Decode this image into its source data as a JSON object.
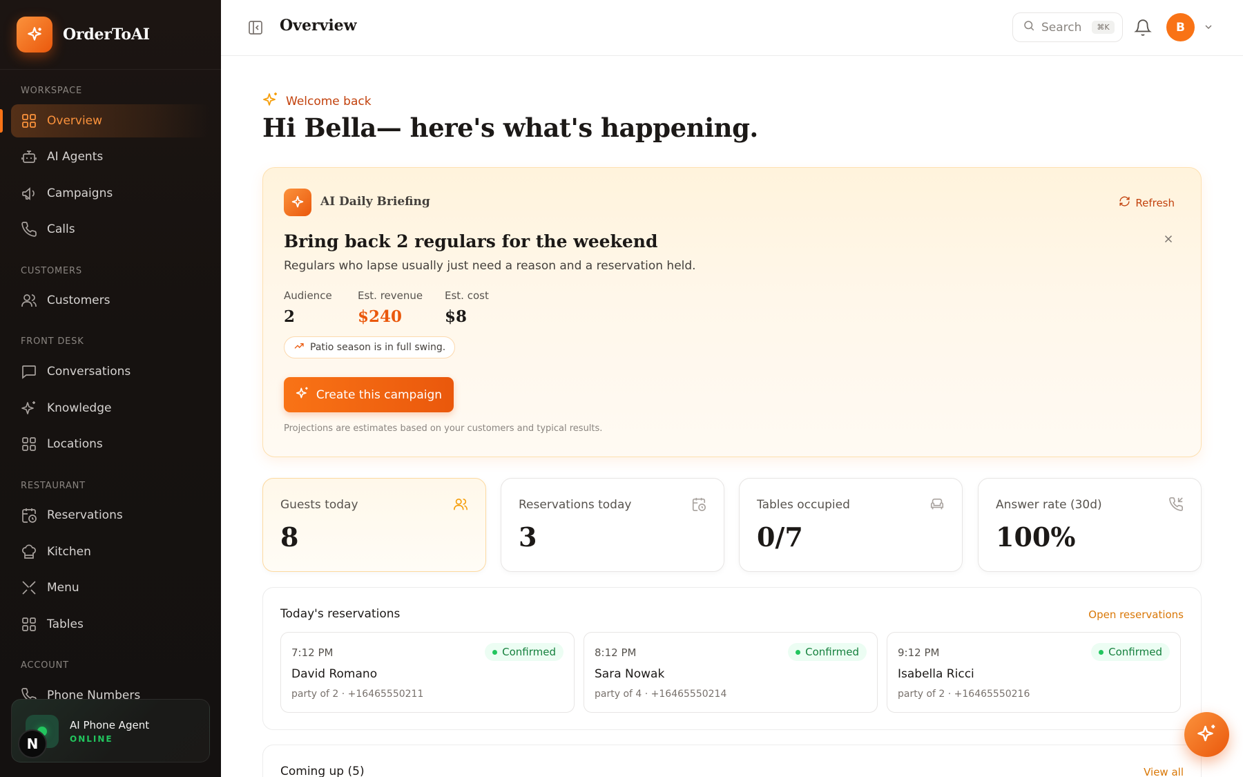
{
  "brand": {
    "name": "OrderToAI",
    "logo_icon": "sparkle-icon"
  },
  "sidebar": {
    "sections": {
      "workspace": "WORKSPACE",
      "customers": "CUSTOMERS",
      "front_desk": "FRONT DESK",
      "restaurant": "RESTAURANT",
      "account": "ACCOUNT"
    },
    "items": {
      "overview": {
        "label": "Overview",
        "icon": "grid-icon",
        "active": true
      },
      "ai_agents": {
        "label": "AI Agents",
        "icon": "robot-icon"
      },
      "campaigns": {
        "label": "Campaigns",
        "icon": "megaphone-icon"
      },
      "calls": {
        "label": "Calls",
        "icon": "phone-icon"
      },
      "customers": {
        "label": "Customers",
        "icon": "users-icon"
      },
      "conversations": {
        "label": "Conversations",
        "icon": "chat-icon"
      },
      "knowledge": {
        "label": "Knowledge",
        "icon": "sparkle-icon"
      },
      "locations": {
        "label": "Locations",
        "icon": "grid-icon"
      },
      "reservations": {
        "label": "Reservations",
        "icon": "calendar-clock-icon"
      },
      "kitchen": {
        "label": "Kitchen",
        "icon": "chef-hat-icon"
      },
      "menu": {
        "label": "Menu",
        "icon": "utensils-icon"
      },
      "tables": {
        "label": "Tables",
        "icon": "grid-icon"
      },
      "phone_numbers": {
        "label": "Phone Numbers",
        "icon": "phone-icon"
      }
    },
    "agent": {
      "title": "AI Phone Agent",
      "status": "ONLINE"
    },
    "user_badge": "N"
  },
  "header": {
    "title": "Overview",
    "search_placeholder": "Search",
    "search_shortcut": "⌘K",
    "avatar_initial": "B"
  },
  "welcome": {
    "label": "Welcome back",
    "greeting": "Hi Bella— here's what's happening."
  },
  "briefing": {
    "label": "AI Daily Briefing",
    "refresh": "Refresh",
    "title": "Bring back 2 regulars for the weekend",
    "subtitle": "Regulars who lapse usually just need a reason and a reservation held.",
    "metrics": {
      "audience": {
        "label": "Audience",
        "value": "2"
      },
      "revenue": {
        "label": "Est. revenue",
        "value": "$240"
      },
      "cost": {
        "label": "Est. cost",
        "value": "$8"
      }
    },
    "tip": "Patio season is in full swing.",
    "cta": "Create this campaign",
    "footnote": "Projections are estimates based on your customers and typical results."
  },
  "stats": {
    "guests": {
      "label": "Guests today",
      "value": "8",
      "icon": "users-icon"
    },
    "reservations": {
      "label": "Reservations today",
      "value": "3",
      "icon": "calendar-clock-icon"
    },
    "tables": {
      "label": "Tables occupied",
      "value": "0/7",
      "icon": "armchair-icon"
    },
    "answer_rate": {
      "label": "Answer rate (30d)",
      "value": "100%",
      "icon": "phone-incoming-icon"
    }
  },
  "todays_reservations": {
    "title": "Today's reservations",
    "link": "Open reservations",
    "items": [
      {
        "time": "7:12 PM",
        "status": "Confirmed",
        "name": "David Romano",
        "detail": "party of 2 · +16465550211"
      },
      {
        "time": "8:12 PM",
        "status": "Confirmed",
        "name": "Sara Nowak",
        "detail": "party of 4 · +16465550214"
      },
      {
        "time": "9:12 PM",
        "status": "Confirmed",
        "name": "Isabella Ricci",
        "detail": "party of 2 · +16465550216"
      }
    ]
  },
  "coming_up": {
    "title": "Coming up (5)",
    "link": "View all"
  },
  "colors": {
    "accent": "#f97316",
    "accent_dark": "#ea580c",
    "success": "#22c55e",
    "sidebar_bg": "#161210"
  }
}
